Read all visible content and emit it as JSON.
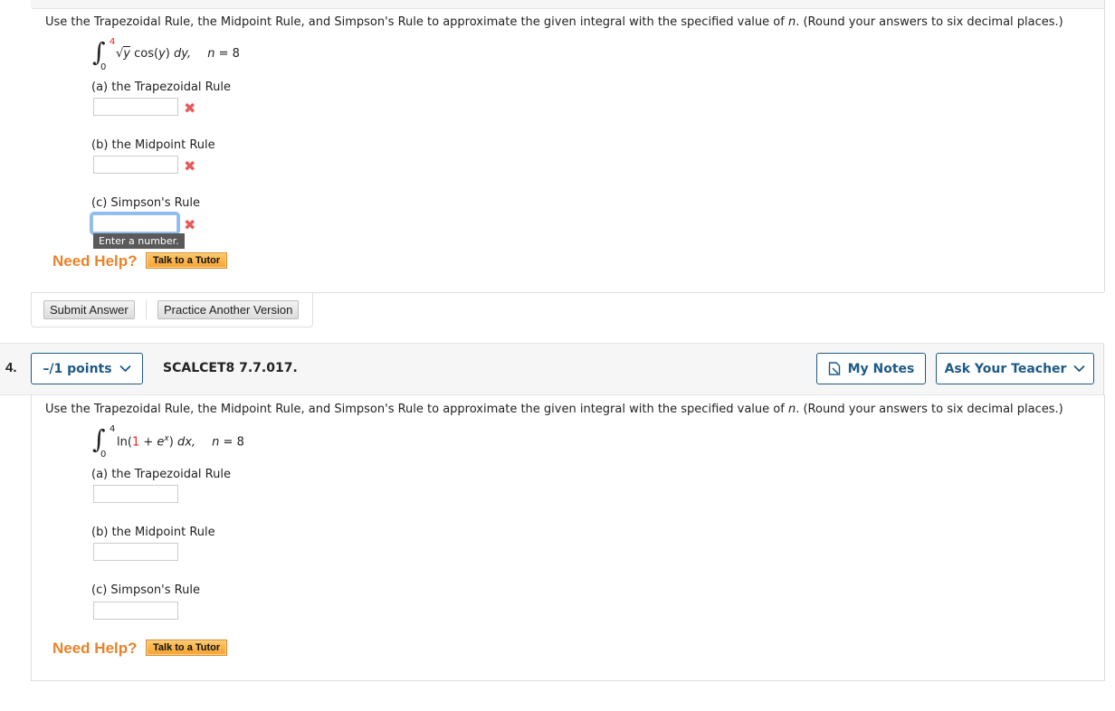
{
  "question3": {
    "prompt_pre": "Use the Trapezoidal Rule, the Midpoint Rule, and Simpson's Rule to approximate the given integral with the specified value of ",
    "prompt_var": "n",
    "prompt_post": ". (Round your answers to six decimal places.)",
    "integral": {
      "upper_limit": "4",
      "lower_limit": "0",
      "integrand_sqrt": "y",
      "integrand_rest": " cos(",
      "integrand_var": "y",
      "integrand_close": ") ",
      "differential": "dy,",
      "n_label": "n",
      "n_value": " = 8"
    },
    "parts": [
      {
        "label": "(a) the Trapezoidal Rule",
        "value": "",
        "status": "incorrect"
      },
      {
        "label": "(b) the Midpoint Rule",
        "value": "",
        "status": "incorrect"
      },
      {
        "label": "(c) Simpson's Rule",
        "value": "",
        "status": "incorrect",
        "focused": true
      }
    ],
    "tooltip": "Enter a number.",
    "need_help": "Need Help?",
    "tutor_button": "Talk to a Tutor",
    "submit_button": "Submit Answer",
    "practice_button": "Practice Another Version"
  },
  "question4": {
    "number": "4.",
    "points_button": "–/1 points",
    "id": "SCALCET8 7.7.017.",
    "my_notes_button": "My Notes",
    "ask_teacher_button": "Ask Your Teacher",
    "prompt_pre": "Use the Trapezoidal Rule, the Midpoint Rule, and Simpson's Rule to approximate the given integral with the specified value of ",
    "prompt_var": "n",
    "prompt_post": ". (Round your answers to six decimal places.)",
    "integral": {
      "upper_limit": "4",
      "lower_limit": "0",
      "fn": "ln(",
      "one": "1",
      "plus": " + ",
      "e": "e",
      "exp": "x",
      "close": ") ",
      "differential": "dx,",
      "n_label": "n",
      "n_value": " = 8"
    },
    "parts": [
      {
        "label": "(a) the Trapezoidal Rule",
        "value": ""
      },
      {
        "label": "(b) the Midpoint Rule",
        "value": ""
      },
      {
        "label": "(c) Simpson's Rule",
        "value": ""
      }
    ],
    "need_help": "Need Help?",
    "tutor_button": "Talk to a Tutor"
  },
  "colors": {
    "accent_blue": "#1d5a85",
    "need_help_orange": "#e8832a",
    "error_red": "#e85a5a",
    "limit_red": "#e8241c"
  }
}
